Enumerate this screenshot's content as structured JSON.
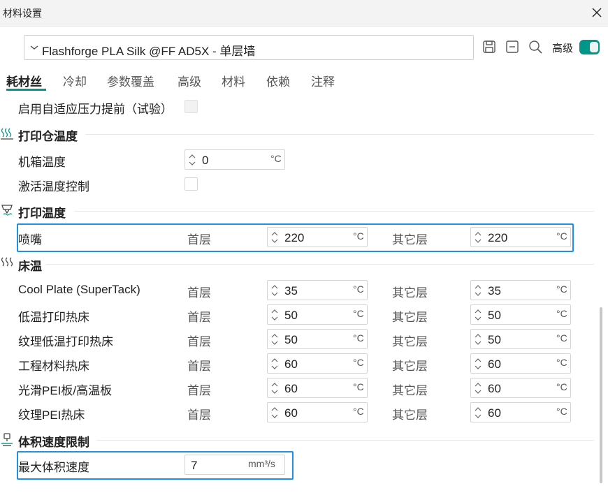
{
  "window": {
    "title": "材料设置",
    "close_icon": "close-icon"
  },
  "preset": {
    "value": "Flashforge PLA Silk @FF AD5X - 单层墙",
    "icons": [
      "chevron-down-icon",
      "save-icon",
      "minus-square-icon",
      "search-icon"
    ]
  },
  "advanced": {
    "label": "高级",
    "enabled": true,
    "toggle_color": "#009688"
  },
  "tabs": [
    {
      "label": "耗材丝",
      "active": true
    },
    {
      "label": "冷却"
    },
    {
      "label": "参数覆盖"
    },
    {
      "label": "高级"
    },
    {
      "label": "材料"
    },
    {
      "label": "依赖"
    },
    {
      "label": "注释"
    }
  ],
  "top_option": {
    "label": "启用自适应压力提前（试验）",
    "checked": false,
    "disabled": true
  },
  "chamber": {
    "title": "打印仓温度",
    "icon": "heat-waves-icon",
    "chamber_temp": {
      "label": "机箱温度",
      "value": "0",
      "unit": "°C"
    },
    "activate_control": {
      "label": "激活温度控制",
      "checked": false
    }
  },
  "print_temp": {
    "title": "打印温度",
    "icon": "nozzle-icon",
    "nozzle": {
      "label": "喷嘴",
      "first_layer_label": "首层",
      "first_layer": "220",
      "other_layers_label": "其它层",
      "other_layers": "220",
      "unit": "°C"
    }
  },
  "bed_temp": {
    "title": "床温",
    "icon": "bed-heat-icon",
    "first_layer_label": "首层",
    "other_layers_label": "其它层",
    "unit": "°C",
    "rows": [
      {
        "label": "Cool Plate (SuperTack)",
        "first": "35",
        "other": "35"
      },
      {
        "label": "低温打印热床",
        "first": "50",
        "other": "50"
      },
      {
        "label": "纹理低温打印热床",
        "first": "50",
        "other": "50"
      },
      {
        "label": "工程材料热床",
        "first": "60",
        "other": "60"
      },
      {
        "label": "光滑PEI板/高温板",
        "first": "60",
        "other": "60"
      },
      {
        "label": "纹理PEI热床",
        "first": "60",
        "other": "60"
      }
    ]
  },
  "volumetric": {
    "title": "体积速度限制",
    "icon": "volume-speed-icon",
    "max_speed": {
      "label": "最大体积速度",
      "value": "7",
      "unit": "mm³/s"
    }
  },
  "colors": {
    "accent": "#009688",
    "highlight": "#1e90e8"
  }
}
